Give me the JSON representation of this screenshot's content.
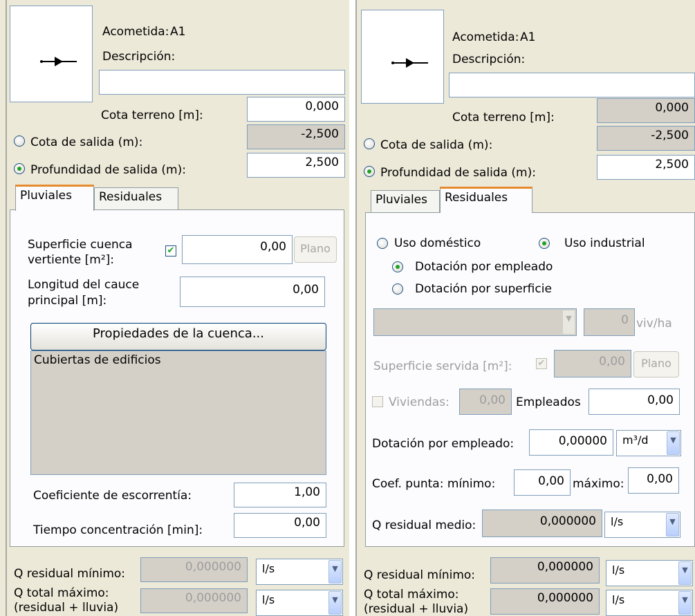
{
  "left": {
    "acometida_label": "Acometida:",
    "acometida_value": "A1",
    "descripcion_label": "Descripción:",
    "descripcion_value": "",
    "cota_terreno_label": "Cota terreno [m]:",
    "cota_terreno_value": "0,000",
    "cota_salida_label": "Cota de salida (m):",
    "cota_salida_value": "-2,500",
    "profundidad_label": "Profundidad de salida (m):",
    "profundidad_value": "2,500",
    "tabs": [
      "Pluviales",
      "Residuales"
    ],
    "active_tab": "Pluviales",
    "superficie_label_1": "Superficie cuenca",
    "superficie_label_2": "vertiente [m²]:",
    "superficie_value": "0,00",
    "plano_label": "Plano",
    "longitud_label_1": "Longitud del cauce",
    "longitud_label_2": "principal [m]:",
    "longitud_value": "0,00",
    "propiedades_button": "Propiedades de la cuenca...",
    "cuenca_list_item": "Cubiertas de edificios",
    "coeficiente_label": "Coeficiente de escorrentía:",
    "coeficiente_value": "1,00",
    "tiempo_label": "Tiempo concentración [min]:",
    "tiempo_value": "0,00",
    "q_residual_minimo_label": "Q residual mínimo:",
    "q_residual_minimo_value": "0,000000",
    "q_residual_minimo_unit": "l/s",
    "q_total_label_1": "Q total máximo:",
    "q_total_label_2": "(residual + lluvia)",
    "q_total_value": "0,000000",
    "q_total_unit": "l/s"
  },
  "right": {
    "acometida_label": "Acometida:",
    "acometida_value": "A1",
    "descripcion_label": "Descripción:",
    "descripcion_value": "",
    "cota_terreno_label": "Cota terreno [m]:",
    "cota_terreno_value": "0,000",
    "cota_salida_label": "Cota de salida (m):",
    "cota_salida_value": "-2,500",
    "profundidad_label": "Profundidad de salida (m):",
    "profundidad_value": "2,500",
    "tabs": [
      "Pluviales",
      "Residuales"
    ],
    "active_tab": "Residuales",
    "uso_domestico": "Uso doméstico",
    "uso_industrial": "Uso industrial",
    "dotacion_empleado_radio": "Dotación por empleado",
    "dotacion_superficie_radio": "Dotación por superficie",
    "combo_value": "",
    "densidad_value": "0",
    "densidad_unit": "viv/ha",
    "superficie_servida_label": "Superficie  servida [m²]:",
    "superficie_servida_value": "0,00",
    "plano_label": "Plano",
    "viviendas_label": "Viviendas:",
    "viviendas_value": "0,00",
    "empleados_label": "Empleados",
    "empleados_value": "0,00",
    "dotacion_label": "Dotación por empleado:",
    "dotacion_value": "0,00000",
    "dotacion_unit": "m³/d",
    "coef_punta_label": "Coef. punta: mínimo:",
    "coef_minimo_value": "0,00",
    "maximo_label": "máximo:",
    "coef_maximo_value": "0,00",
    "q_residual_medio_label": "Q residual medio:",
    "q_residual_medio_value": "0,000000",
    "q_residual_medio_unit": "l/s",
    "q_residual_minimo_label": "Q residual mínimo:",
    "q_residual_minimo_value": "0,000000",
    "q_residual_minimo_unit": "l/s",
    "q_total_label_1": "Q total máximo:",
    "q_total_label_2": "(residual + lluvia)",
    "q_total_value": "0,000000",
    "q_total_unit": "l/s"
  },
  "icons": {
    "connection_arrow": "connection-arrow-icon",
    "dropdown": "chevron-down-icon",
    "check": "check-icon"
  },
  "colors": {
    "panel_bg": "#ece9d8",
    "active_tab_accent": "#e68b2c",
    "radio_dot": "#21a121",
    "field_border": "#7f9db9",
    "readonly_bg": "#d4d0c8"
  }
}
